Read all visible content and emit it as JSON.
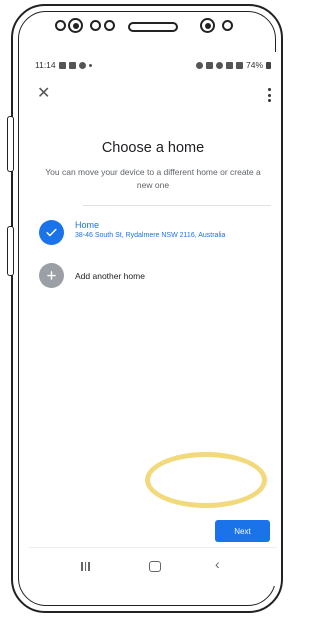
{
  "status_bar": {
    "time": "11:14",
    "battery": "74%"
  },
  "header": {
    "close_icon": "close-icon",
    "more_icon": "more-vert-icon"
  },
  "main": {
    "title": "Choose a home",
    "subtitle": "You can move your device to a different home or create a new one",
    "homes": [
      {
        "name": "Home",
        "address": "38-46 South St, Rydalmere NSW 2116, Australia",
        "selected": true
      }
    ],
    "add_home_label": "Add another home"
  },
  "actions": {
    "next_label": "Next"
  },
  "colors": {
    "accent": "#1a73e8",
    "highlight": "#f0d264"
  }
}
